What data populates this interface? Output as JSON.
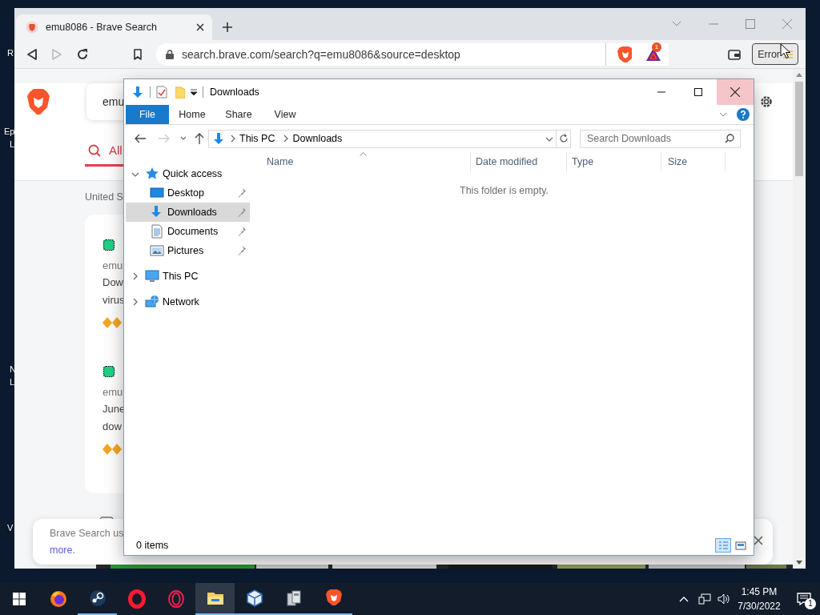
{
  "desktop": {
    "icon_label_fragments": [
      {
        "text": "R"
      },
      {
        "text": "Ep"
      },
      {
        "text": "L"
      },
      {
        "text": "N"
      },
      {
        "text": "L"
      },
      {
        "text": "V"
      }
    ]
  },
  "browser": {
    "tabs": [
      {
        "title": "emu8086 - Brave Search",
        "selected": true
      }
    ],
    "address": "search.brave.com/search?q=emu8086&source=desktop",
    "rewards_badge": "1",
    "status_button": "Error",
    "page": {
      "search_query": "emu",
      "search_tabs": [
        {
          "label": "All",
          "selected": true
        }
      ],
      "region": "United S",
      "results": [
        {
          "site": "emu",
          "snippet_lines": [
            "Dow",
            "virus"
          ]
        },
        {
          "site": "emu",
          "snippet_lines": [
            "June",
            "dow"
          ]
        }
      ],
      "cookie_notice": {
        "text": "Brave Search us",
        "link": "more."
      }
    }
  },
  "explorer": {
    "title": "Downloads",
    "ribbon_tabs": [
      {
        "label": "File",
        "kind": "menu"
      },
      {
        "label": "Home",
        "kind": "tab"
      },
      {
        "label": "Share",
        "kind": "tab"
      },
      {
        "label": "View",
        "kind": "tab"
      }
    ],
    "breadcrumb": [
      "This PC",
      "Downloads"
    ],
    "search": {
      "placeholder": "Search Downloads"
    },
    "columns": [
      {
        "label": "Name",
        "sorted": true
      },
      {
        "label": "Date modified",
        "sorted": false
      },
      {
        "label": "Type",
        "sorted": false
      },
      {
        "label": "Size",
        "sorted": false
      }
    ],
    "empty_message": "This folder is empty.",
    "nav": [
      {
        "label": "Quick access",
        "kind": "quick-access",
        "expanded": true,
        "selected": false,
        "children": [
          {
            "label": "Desktop",
            "kind": "desktop",
            "pinned": true,
            "selected": false
          },
          {
            "label": "Downloads",
            "kind": "downloads",
            "pinned": true,
            "selected": true
          },
          {
            "label": "Documents",
            "kind": "documents",
            "pinned": true,
            "selected": false
          },
          {
            "label": "Pictures",
            "kind": "pictures",
            "pinned": true,
            "selected": false
          }
        ]
      },
      {
        "label": "This PC",
        "kind": "pc",
        "expanded": false,
        "selected": false
      },
      {
        "label": "Network",
        "kind": "network",
        "expanded": false,
        "selected": false
      }
    ],
    "status": "0 items",
    "views": [
      {
        "kind": "details",
        "selected": true
      },
      {
        "kind": "tiles",
        "selected": false
      }
    ]
  },
  "taskbar": {
    "apps": [
      {
        "kind": "firefox",
        "running": false,
        "active": false
      },
      {
        "kind": "steam",
        "running": true,
        "active": false
      },
      {
        "kind": "opera",
        "running": false,
        "active": false
      },
      {
        "kind": "opera-gx",
        "running": false,
        "active": false
      },
      {
        "kind": "explorer",
        "running": true,
        "active": true
      },
      {
        "kind": "virtualbox",
        "running": true,
        "active": false
      },
      {
        "kind": "installer",
        "running": true,
        "active": false
      },
      {
        "kind": "brave",
        "running": true,
        "active": false
      }
    ],
    "time": "1:45 PM",
    "date": "7/30/2022",
    "notification_count": "1"
  }
}
